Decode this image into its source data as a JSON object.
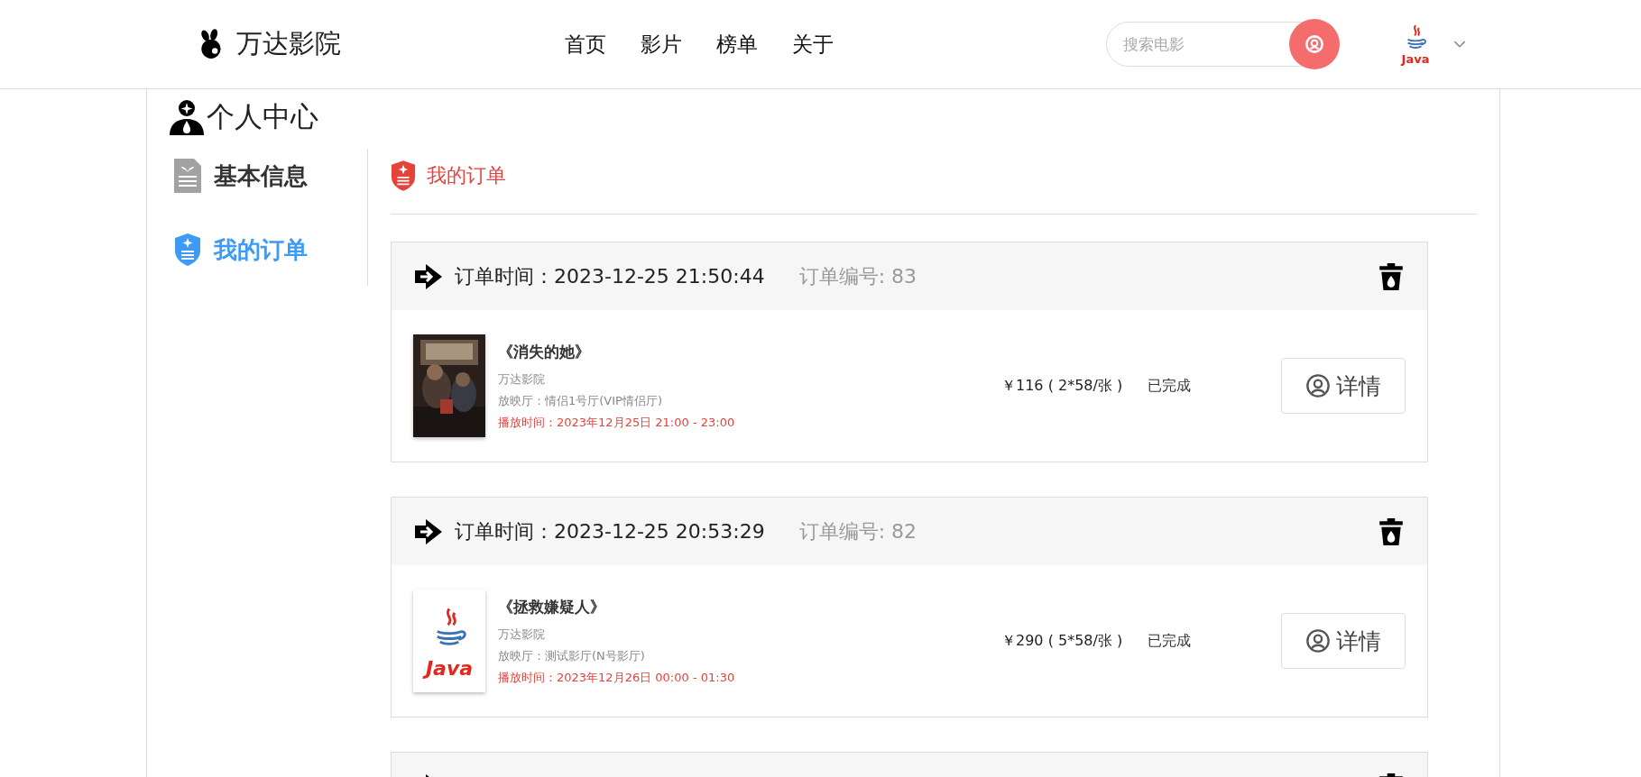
{
  "brand": {
    "name": "万达影院"
  },
  "nav": [
    {
      "label": "首页"
    },
    {
      "label": "影片"
    },
    {
      "label": "榜单"
    },
    {
      "label": "关于"
    }
  ],
  "search": {
    "placeholder": "搜索电影"
  },
  "user": {
    "avatar_text": "Java"
  },
  "sidebar": {
    "title": "个人中心",
    "items": [
      {
        "label": "基本信息",
        "kind": "info",
        "selected": false
      },
      {
        "label": "我的订单",
        "kind": "orders",
        "selected": true
      }
    ]
  },
  "content": {
    "heading": "我的订单"
  },
  "orders": [
    {
      "time": "订单时间：2023-12-25 21:50:44",
      "number": "订单编号: 83",
      "movie": "《消失的她》",
      "cinema": "万达影院",
      "hall": "放映厅：情侣1号厅(VIP情侣厅)",
      "showtime": "播放时间：2023年12月25日 21:00 - 23:00",
      "price": "￥116 ( 2*58/张 )",
      "status": "已完成",
      "button": "详情"
    },
    {
      "time": "订单时间：2023-12-25 20:53:29",
      "number": "订单编号: 82",
      "poster": {
        "kind": "logo",
        "text": "Java"
      },
      "movie": "《拯救嫌疑人》",
      "cinema": "万达影院",
      "hall": "放映厅：测试影厅(N号影厅)",
      "showtime": "播放时间：2023年12月26日 00:00 - 01:30",
      "price": "￥290 ( 5*58/张 )",
      "status": "已完成",
      "button": "详情"
    },
    {
      "cut": true
    }
  ]
}
